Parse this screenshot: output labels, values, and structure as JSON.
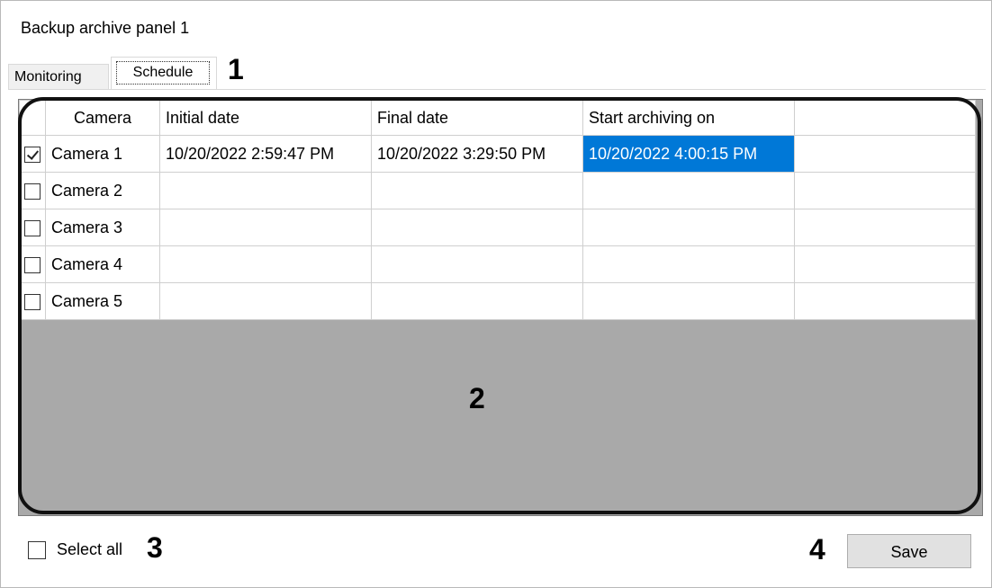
{
  "window": {
    "title": "Backup archive panel 1"
  },
  "tabs": [
    {
      "label": "Monitoring",
      "selected": false
    },
    {
      "label": "Schedule",
      "selected": true
    }
  ],
  "annotations": {
    "a1": "1",
    "a2": "2",
    "a3": "3",
    "a4": "4"
  },
  "grid": {
    "columns": [
      "",
      "Camera",
      "Initial date",
      "Final date",
      "Start archiving on",
      ""
    ],
    "rows": [
      {
        "checked": true,
        "camera": "Camera 1",
        "initial": "10/20/2022 2:59:47 PM",
        "final": "10/20/2022 3:29:50 PM",
        "start": "10/20/2022 4:00:15 PM"
      },
      {
        "checked": false,
        "camera": "Camera 2",
        "initial": "",
        "final": "",
        "start": ""
      },
      {
        "checked": false,
        "camera": "Camera 3",
        "initial": "",
        "final": "",
        "start": ""
      },
      {
        "checked": false,
        "camera": "Camera 4",
        "initial": "",
        "final": "",
        "start": ""
      },
      {
        "checked": false,
        "camera": "Camera 5",
        "initial": "",
        "final": "",
        "start": ""
      }
    ],
    "selected_cell_color": "#0078d7"
  },
  "footer": {
    "select_all_label": "Select all",
    "select_all_checked": false,
    "save_label": "Save"
  }
}
